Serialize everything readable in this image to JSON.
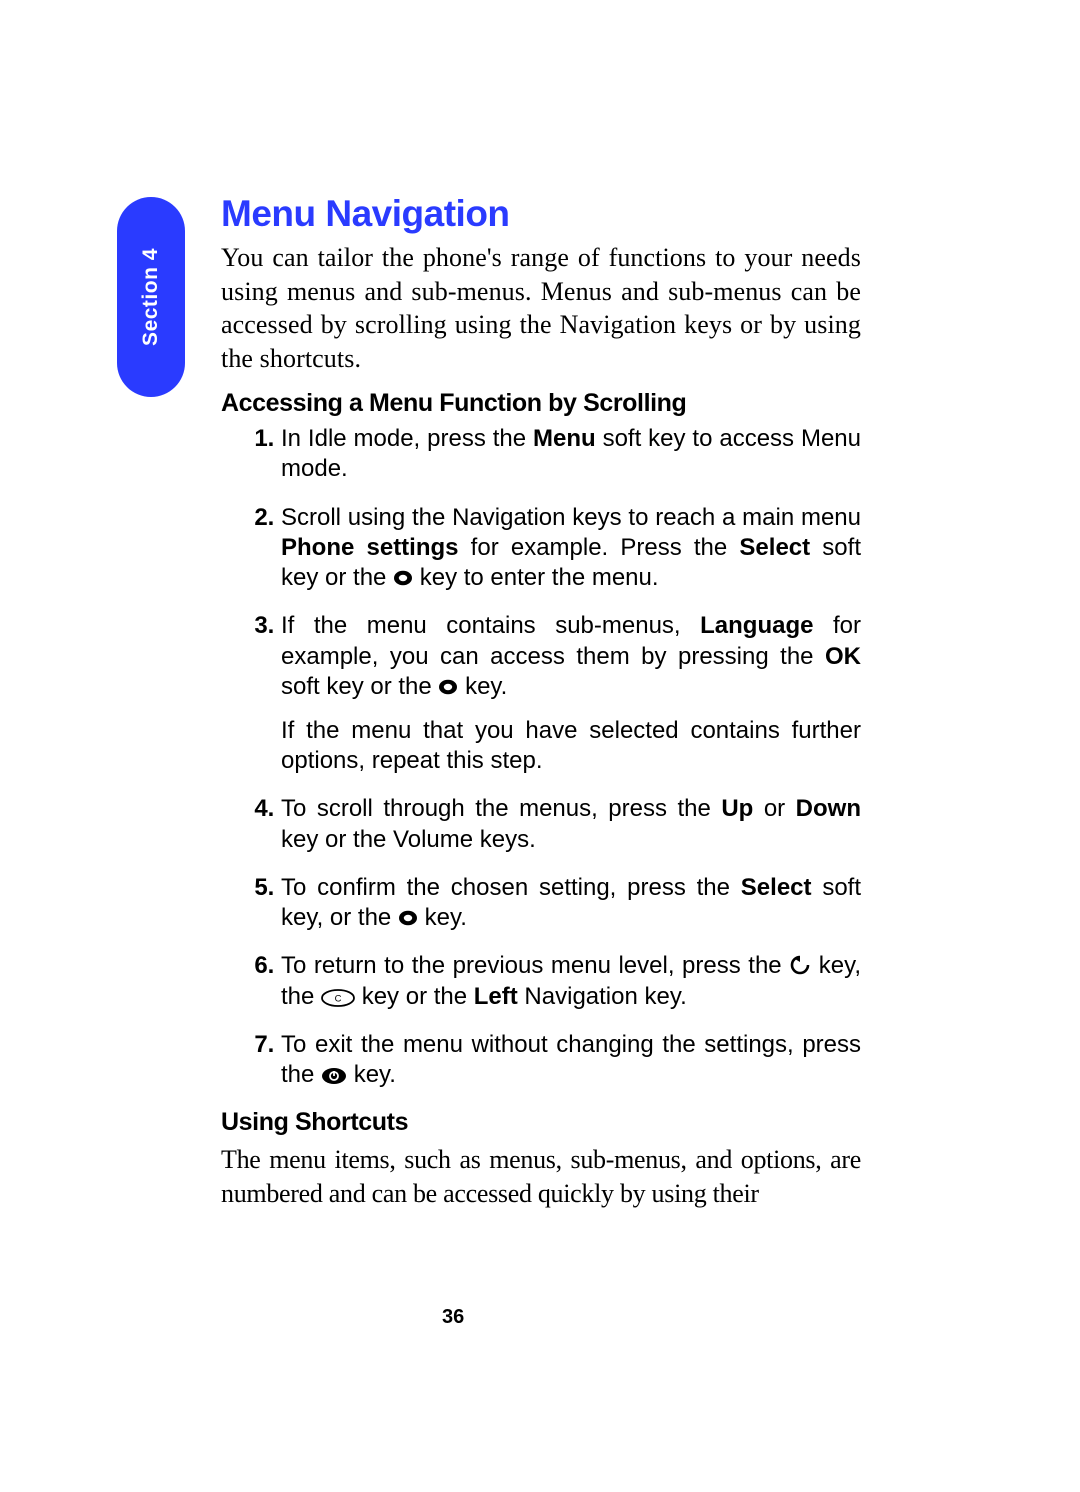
{
  "section_tab": {
    "label": "Section 4"
  },
  "title": "Menu Navigation",
  "intro": "You can tailor the phone's range of functions to your needs using menus and sub-menus. Menus and sub-menus can be accessed by scrolling using the Navigation keys or by using the shortcuts.",
  "subhead_scroll": "Accessing a Menu Function by Scrolling",
  "steps": {
    "s1a": "In Idle mode, press the ",
    "s1b": "Menu",
    "s1c": " soft key to access Menu mode.",
    "s2a": "Scroll using the Navigation keys to reach a main menu ",
    "s2b": "Phone settings",
    "s2c": " for example. Press the ",
    "s2d": "Select",
    "s2e": " soft key or the ",
    "s2f": " key to enter the menu.",
    "s3a": "If the menu contains sub-menus, ",
    "s3b": "Language",
    "s3c": " for example, you can access them by pressing the ",
    "s3d": "OK",
    "s3e": " soft key or the ",
    "s3f": " key.",
    "s3g": "If the menu that you have selected contains further options, repeat this step.",
    "s4a": "To scroll through the menus, press the ",
    "s4b": "Up",
    "s4c": " or ",
    "s4d": "Down",
    "s4e": " key or the Volume keys.",
    "s5a": "To confirm the chosen setting, press the ",
    "s5b": "Select",
    "s5c": " soft key, or the ",
    "s5d": " key.",
    "s6a": "To return to the previous menu level, press the ",
    "s6b": " key, the ",
    "s6c": " key or the ",
    "s6d": "Left",
    "s6e": " Navigation key.",
    "s7a": "To exit the menu without changing the settings, press the ",
    "s7b": " key."
  },
  "subhead_shortcuts": "Using Shortcuts",
  "shortcuts_para": "The menu items, such as menus, sub-menus, and options, are numbered and can be accessed quickly by using their",
  "page_number": "36"
}
